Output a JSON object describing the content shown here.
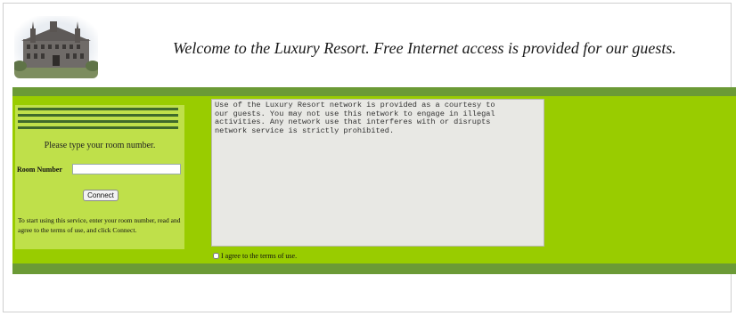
{
  "header": {
    "logo_alt": "Luxury Resort building",
    "welcome": "Welcome to the Luxury Resort. Free Internet access is provided for our guests."
  },
  "login": {
    "prompt": "Please type your room number.",
    "room_label": "Room Number",
    "room_value": "",
    "connect_label": "Connect",
    "instructions": "To start using this service, enter your room number, read and agree to the terms of use, and click Connect."
  },
  "terms": {
    "text": "Use of the Luxury Resort network is provided as a courtesy to\nour guests. You may not use this network to engage in illegal\nactivities. Any network use that interferes with or disrupts\nnetwork service is strictly prohibited.",
    "agree_label": "I agree to the terms of use.",
    "agreed": false
  },
  "colors": {
    "page_green": "#99cc00",
    "band_green": "#6b9a36",
    "panel_green": "#bfe04a",
    "stripe_dark": "#3f6a2b",
    "terms_bg": "#e8e8e4"
  }
}
